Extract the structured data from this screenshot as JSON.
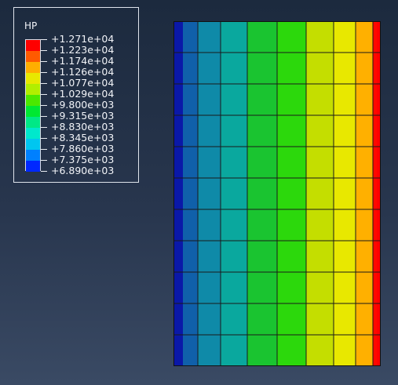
{
  "legend": {
    "title": "HP",
    "labels": [
      "+1.271e+04",
      "+1.223e+04",
      "+1.174e+04",
      "+1.126e+04",
      "+1.077e+04",
      "+1.029e+04",
      "+9.800e+03",
      "+9.315e+03",
      "+8.830e+03",
      "+8.345e+03",
      "+7.860e+03",
      "+7.375e+03",
      "+6.890e+03"
    ],
    "colors": [
      "#ff0000",
      "#ff5a00",
      "#ffae00",
      "#e8e800",
      "#b2ee00",
      "#4ce800",
      "#00e832",
      "#00e886",
      "#00e8cc",
      "#00c6f0",
      "#0080ff",
      "#0028ff"
    ]
  },
  "mesh": {
    "rows": 11,
    "column_colors": [
      "#0a18a8",
      "#1060aa",
      "#0f8aa8",
      "#0aa89e",
      "#1ac430",
      "#2cd80c",
      "#c4de00",
      "#e8e800",
      "#ffb000",
      "#ff0800",
      "#ff0000"
    ]
  }
}
